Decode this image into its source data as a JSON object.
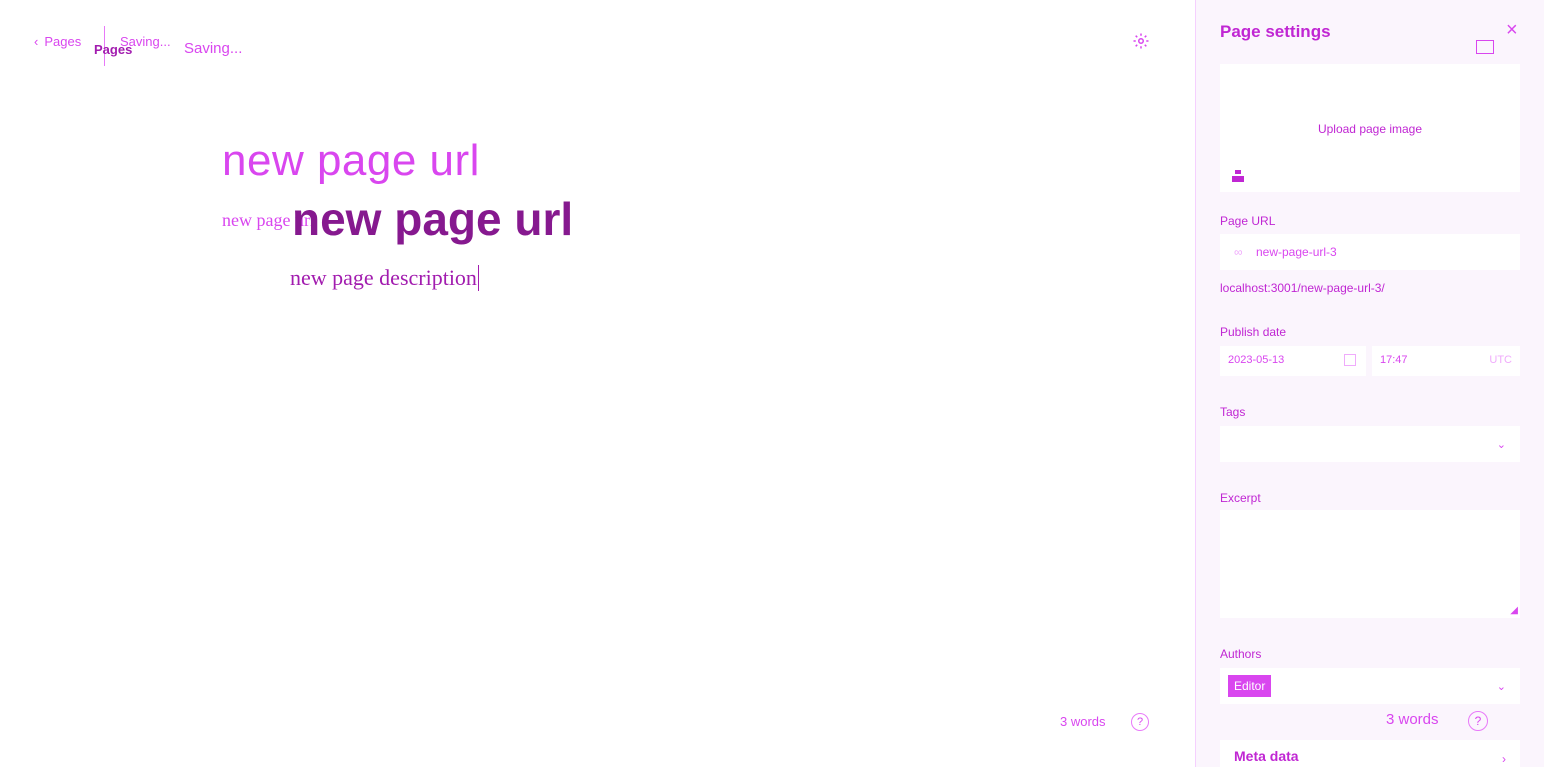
{
  "topbar": {
    "back_label": "Pages",
    "breadcrumb_bold": "Pages",
    "status_small": "Saving...",
    "status_big": "Saving..."
  },
  "editor": {
    "title": "new page url",
    "title_ghost": "new page url",
    "title_bold": "new page url",
    "description": "new page description",
    "word_count": "3 words"
  },
  "panel": {
    "title": "Page settings",
    "upload_label": "Upload page image",
    "url_label": "Page URL",
    "url_value": "new-page-url-3",
    "url_hint": "localhost:3001/new-page-url-3/",
    "publish_label": "Publish date",
    "date_value": "2023-05-13",
    "time_value": "17:47",
    "tz_value": "UTC",
    "tags_label": "Tags",
    "excerpt_label": "Excerpt",
    "authors_label": "Authors",
    "author_chip": "Editor",
    "word_count_overlay": "3 words",
    "meta_label": "Meta data"
  },
  "icons": {
    "back": "chevron-left-icon",
    "settings": "gear-icon",
    "close": "close-icon",
    "help": "question-icon",
    "link": "link-icon",
    "calendar": "calendar-icon",
    "dropdown": "chevron-down-icon",
    "expand": "chevron-right-icon"
  },
  "colors": {
    "accent": "#d946ef",
    "accent_dark": "#86198f",
    "panel_bg": "#fbf5fd"
  }
}
